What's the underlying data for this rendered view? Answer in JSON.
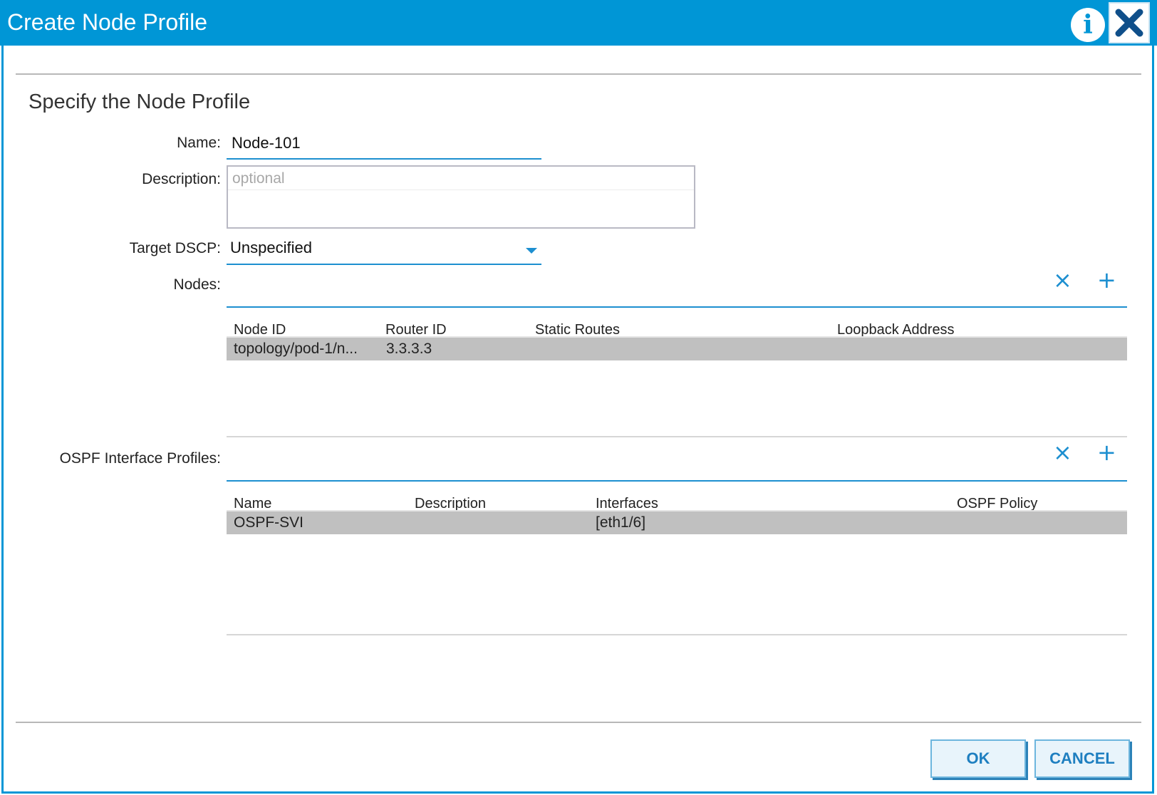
{
  "window": {
    "title": "Create Node Profile"
  },
  "section": {
    "title": "Specify the Node Profile"
  },
  "form": {
    "name_label": "Name:",
    "name_value": "Node-101",
    "description_label": "Description:",
    "description_placeholder": "optional",
    "target_dscp_label": "Target DSCP:",
    "target_dscp_value": "Unspecified",
    "nodes_label": "Nodes:",
    "ospf_label": "OSPF Interface Profiles:"
  },
  "nodes_table": {
    "columns": [
      "Node ID",
      "Router ID",
      "Static Routes",
      "Loopback Address"
    ],
    "rows": [
      {
        "node_id": "topology/pod-1/n...",
        "router_id": "3.3.3.3",
        "static_routes": "",
        "loopback": ""
      }
    ]
  },
  "ospf_table": {
    "columns": [
      "Name",
      "Description",
      "Interfaces",
      "OSPF Policy"
    ],
    "rows": [
      {
        "name": "OSPF-SVI",
        "description": "",
        "interfaces": "[eth1/6]",
        "ospf_policy": ""
      }
    ]
  },
  "icons": {
    "info": "i",
    "delete": "×",
    "add": "+"
  },
  "buttons": {
    "ok": "OK",
    "cancel": "CANCEL"
  },
  "colors": {
    "accent": "#0096d6",
    "selected_row": "#c0c0c0"
  }
}
